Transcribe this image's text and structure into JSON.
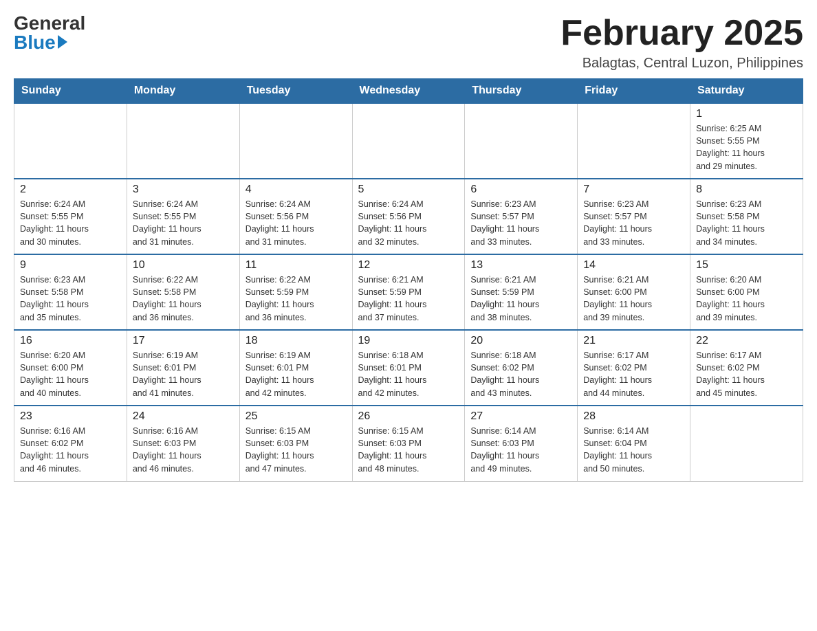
{
  "header": {
    "logo_general": "General",
    "logo_blue": "Blue",
    "month_title": "February 2025",
    "location": "Balagtas, Central Luzon, Philippines"
  },
  "weekdays": [
    "Sunday",
    "Monday",
    "Tuesday",
    "Wednesday",
    "Thursday",
    "Friday",
    "Saturday"
  ],
  "weeks": [
    [
      {
        "day": "",
        "info": ""
      },
      {
        "day": "",
        "info": ""
      },
      {
        "day": "",
        "info": ""
      },
      {
        "day": "",
        "info": ""
      },
      {
        "day": "",
        "info": ""
      },
      {
        "day": "",
        "info": ""
      },
      {
        "day": "1",
        "info": "Sunrise: 6:25 AM\nSunset: 5:55 PM\nDaylight: 11 hours\nand 29 minutes."
      }
    ],
    [
      {
        "day": "2",
        "info": "Sunrise: 6:24 AM\nSunset: 5:55 PM\nDaylight: 11 hours\nand 30 minutes."
      },
      {
        "day": "3",
        "info": "Sunrise: 6:24 AM\nSunset: 5:55 PM\nDaylight: 11 hours\nand 31 minutes."
      },
      {
        "day": "4",
        "info": "Sunrise: 6:24 AM\nSunset: 5:56 PM\nDaylight: 11 hours\nand 31 minutes."
      },
      {
        "day": "5",
        "info": "Sunrise: 6:24 AM\nSunset: 5:56 PM\nDaylight: 11 hours\nand 32 minutes."
      },
      {
        "day": "6",
        "info": "Sunrise: 6:23 AM\nSunset: 5:57 PM\nDaylight: 11 hours\nand 33 minutes."
      },
      {
        "day": "7",
        "info": "Sunrise: 6:23 AM\nSunset: 5:57 PM\nDaylight: 11 hours\nand 33 minutes."
      },
      {
        "day": "8",
        "info": "Sunrise: 6:23 AM\nSunset: 5:58 PM\nDaylight: 11 hours\nand 34 minutes."
      }
    ],
    [
      {
        "day": "9",
        "info": "Sunrise: 6:23 AM\nSunset: 5:58 PM\nDaylight: 11 hours\nand 35 minutes."
      },
      {
        "day": "10",
        "info": "Sunrise: 6:22 AM\nSunset: 5:58 PM\nDaylight: 11 hours\nand 36 minutes."
      },
      {
        "day": "11",
        "info": "Sunrise: 6:22 AM\nSunset: 5:59 PM\nDaylight: 11 hours\nand 36 minutes."
      },
      {
        "day": "12",
        "info": "Sunrise: 6:21 AM\nSunset: 5:59 PM\nDaylight: 11 hours\nand 37 minutes."
      },
      {
        "day": "13",
        "info": "Sunrise: 6:21 AM\nSunset: 5:59 PM\nDaylight: 11 hours\nand 38 minutes."
      },
      {
        "day": "14",
        "info": "Sunrise: 6:21 AM\nSunset: 6:00 PM\nDaylight: 11 hours\nand 39 minutes."
      },
      {
        "day": "15",
        "info": "Sunrise: 6:20 AM\nSunset: 6:00 PM\nDaylight: 11 hours\nand 39 minutes."
      }
    ],
    [
      {
        "day": "16",
        "info": "Sunrise: 6:20 AM\nSunset: 6:00 PM\nDaylight: 11 hours\nand 40 minutes."
      },
      {
        "day": "17",
        "info": "Sunrise: 6:19 AM\nSunset: 6:01 PM\nDaylight: 11 hours\nand 41 minutes."
      },
      {
        "day": "18",
        "info": "Sunrise: 6:19 AM\nSunset: 6:01 PM\nDaylight: 11 hours\nand 42 minutes."
      },
      {
        "day": "19",
        "info": "Sunrise: 6:18 AM\nSunset: 6:01 PM\nDaylight: 11 hours\nand 42 minutes."
      },
      {
        "day": "20",
        "info": "Sunrise: 6:18 AM\nSunset: 6:02 PM\nDaylight: 11 hours\nand 43 minutes."
      },
      {
        "day": "21",
        "info": "Sunrise: 6:17 AM\nSunset: 6:02 PM\nDaylight: 11 hours\nand 44 minutes."
      },
      {
        "day": "22",
        "info": "Sunrise: 6:17 AM\nSunset: 6:02 PM\nDaylight: 11 hours\nand 45 minutes."
      }
    ],
    [
      {
        "day": "23",
        "info": "Sunrise: 6:16 AM\nSunset: 6:02 PM\nDaylight: 11 hours\nand 46 minutes."
      },
      {
        "day": "24",
        "info": "Sunrise: 6:16 AM\nSunset: 6:03 PM\nDaylight: 11 hours\nand 46 minutes."
      },
      {
        "day": "25",
        "info": "Sunrise: 6:15 AM\nSunset: 6:03 PM\nDaylight: 11 hours\nand 47 minutes."
      },
      {
        "day": "26",
        "info": "Sunrise: 6:15 AM\nSunset: 6:03 PM\nDaylight: 11 hours\nand 48 minutes."
      },
      {
        "day": "27",
        "info": "Sunrise: 6:14 AM\nSunset: 6:03 PM\nDaylight: 11 hours\nand 49 minutes."
      },
      {
        "day": "28",
        "info": "Sunrise: 6:14 AM\nSunset: 6:04 PM\nDaylight: 11 hours\nand 50 minutes."
      },
      {
        "day": "",
        "info": ""
      }
    ]
  ]
}
